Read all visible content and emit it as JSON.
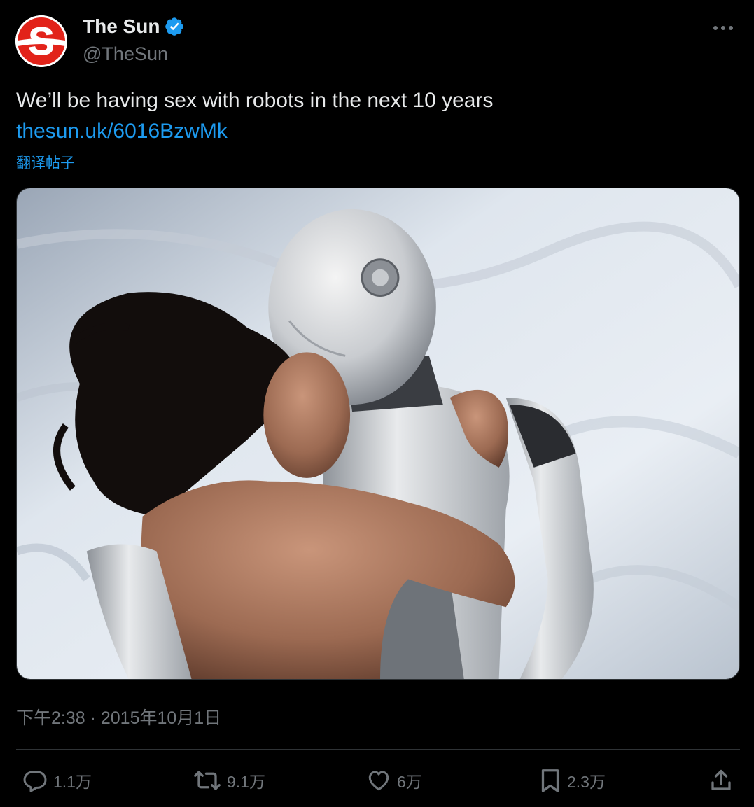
{
  "author": {
    "name": "The Sun",
    "handle": "@TheSun",
    "avatar_letter": "S",
    "verified": true
  },
  "tweet": {
    "text": "We’ll be having sex with robots in the next 10 years",
    "link": "thesun.uk/6016BzwMk",
    "translate_label": "翻译帖子",
    "timestamp": "下午2:38 · 2015年10月1日"
  },
  "actions": {
    "reply_count": "1.1万",
    "retweet_count": "9.1万",
    "like_count": "6万",
    "bookmark_count": "2.3万"
  },
  "colors": {
    "background": "#000000",
    "text": "#e7e9ea",
    "muted": "#71767b",
    "link": "#1d9bf0",
    "brand_red": "#e2231a",
    "verified_blue": "#1d9bf0"
  },
  "icons": {
    "verified": "verified-badge-icon",
    "more": "more-dots-icon",
    "reply": "reply-bubble-icon",
    "retweet": "retweet-arrows-icon",
    "like": "heart-icon",
    "bookmark": "bookmark-icon",
    "share": "share-upload-icon"
  }
}
